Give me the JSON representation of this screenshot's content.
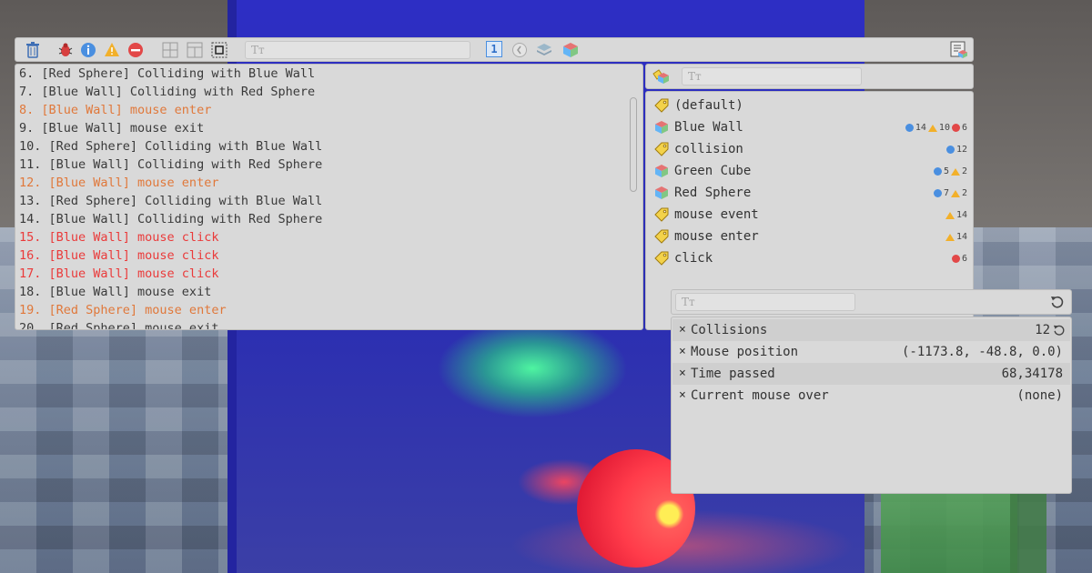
{
  "toolbar": {
    "search_placeholder": "Tт",
    "page_number": "1"
  },
  "log": {
    "lines": [
      {
        "text": "6. [Red Sphere] Colliding with Blue Wall",
        "level": "normal"
      },
      {
        "text": "7. [Blue Wall] Colliding with Red Sphere",
        "level": "normal"
      },
      {
        "text": "8. [Blue Wall] mouse enter",
        "level": "orange"
      },
      {
        "text": "9. [Blue Wall] mouse exit",
        "level": "normal"
      },
      {
        "text": "10. [Red Sphere] Colliding with Blue Wall",
        "level": "normal"
      },
      {
        "text": "11. [Blue Wall] Colliding with Red Sphere",
        "level": "normal"
      },
      {
        "text": "12. [Blue Wall] mouse enter",
        "level": "orange"
      },
      {
        "text": "13. [Red Sphere] Colliding with Blue Wall",
        "level": "normal"
      },
      {
        "text": "14. [Blue Wall] Colliding with Red Sphere",
        "level": "normal"
      },
      {
        "text": "15. [Blue Wall] mouse click",
        "level": "red"
      },
      {
        "text": "16. [Blue Wall] mouse click",
        "level": "red"
      },
      {
        "text": "17. [Blue Wall] mouse click",
        "level": "red"
      },
      {
        "text": "18. [Blue Wall] mouse exit",
        "level": "normal"
      },
      {
        "text": "19. [Red Sphere] mouse enter",
        "level": "orange"
      },
      {
        "text": "20. [Red Sphere] mouse exit",
        "level": "normal"
      }
    ]
  },
  "tags": {
    "search_placeholder": "Tт",
    "items": [
      {
        "label": "(default)",
        "icon": "tag-icon",
        "info": "",
        "warn": "",
        "err": ""
      },
      {
        "label": "Blue Wall",
        "icon": "cube-icon",
        "info": "14",
        "warn": "10",
        "err": "6"
      },
      {
        "label": "collision",
        "icon": "tag-icon",
        "info": "12",
        "warn": "",
        "err": ""
      },
      {
        "label": "Green Cube",
        "icon": "cube-icon",
        "info": "5",
        "warn": "2",
        "err": ""
      },
      {
        "label": "Red Sphere",
        "icon": "cube-icon",
        "info": "7",
        "warn": "2",
        "err": ""
      },
      {
        "label": "mouse event",
        "icon": "tag-icon",
        "info": "",
        "warn": "14",
        "err": ""
      },
      {
        "label": "mouse enter",
        "icon": "tag-icon",
        "info": "",
        "warn": "14",
        "err": ""
      },
      {
        "label": "click",
        "icon": "tag-icon",
        "info": "",
        "warn": "",
        "err": "6"
      }
    ]
  },
  "watch": {
    "search_placeholder": "Tт",
    "rows": [
      {
        "label": "Collisions",
        "value": "12"
      },
      {
        "label": "Mouse position",
        "value": "(-1173.8, -48.8, 0.0)"
      },
      {
        "label": "Time passed",
        "value": "68,34178"
      },
      {
        "label": "Current mouse over",
        "value": "(none)"
      }
    ]
  },
  "colors": {
    "info": "#4a8fe0",
    "warning": "#f2b02a",
    "error": "#e24848",
    "log_orange": "#e0783a",
    "log_red": "#ea3a3a",
    "wall_blue": "#2b2eb2"
  }
}
